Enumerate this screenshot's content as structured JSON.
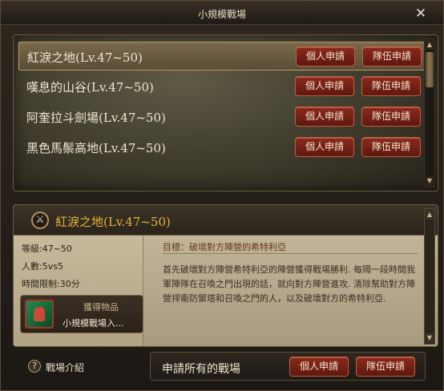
{
  "window": {
    "title": "小規模戰場",
    "close_label": "✕"
  },
  "battlefields": [
    {
      "name": "紅淚之地(Lv.47~50)",
      "selected": true
    },
    {
      "name": "嘆息的山谷(Lv.47~50)",
      "selected": false
    },
    {
      "name": "阿奎拉斗劍場(Lv.47~50)",
      "selected": false
    },
    {
      "name": "黑色馬鬃高地(Lv.47~50)",
      "selected": false
    }
  ],
  "buttons": {
    "personal": "個人申請",
    "party": "隊伍申請"
  },
  "detail": {
    "title": "紅淚之地(Lv.47~50)",
    "level": "等級:47~50",
    "players": "人數:5vs5",
    "time_limit": "時間限制:30分",
    "reward_label": "獲得物品",
    "reward_item": "小規模戰場入...",
    "objective": "目標：破壞對方陣營的希特利亞",
    "description": "首先破壞對方陣營希特利亞的陣營獲得戰場勝利. 每隔一段時間我軍陣隊在召喚之門出現的話，就向對方陣營進攻. 清除幫助對方陣營捍衛防禦塔和召喚之門的人，以及破壞對方的希特利亞."
  },
  "footer": {
    "help_label": "戰場介紹",
    "apply_all_label": "申請所有的戰場"
  }
}
